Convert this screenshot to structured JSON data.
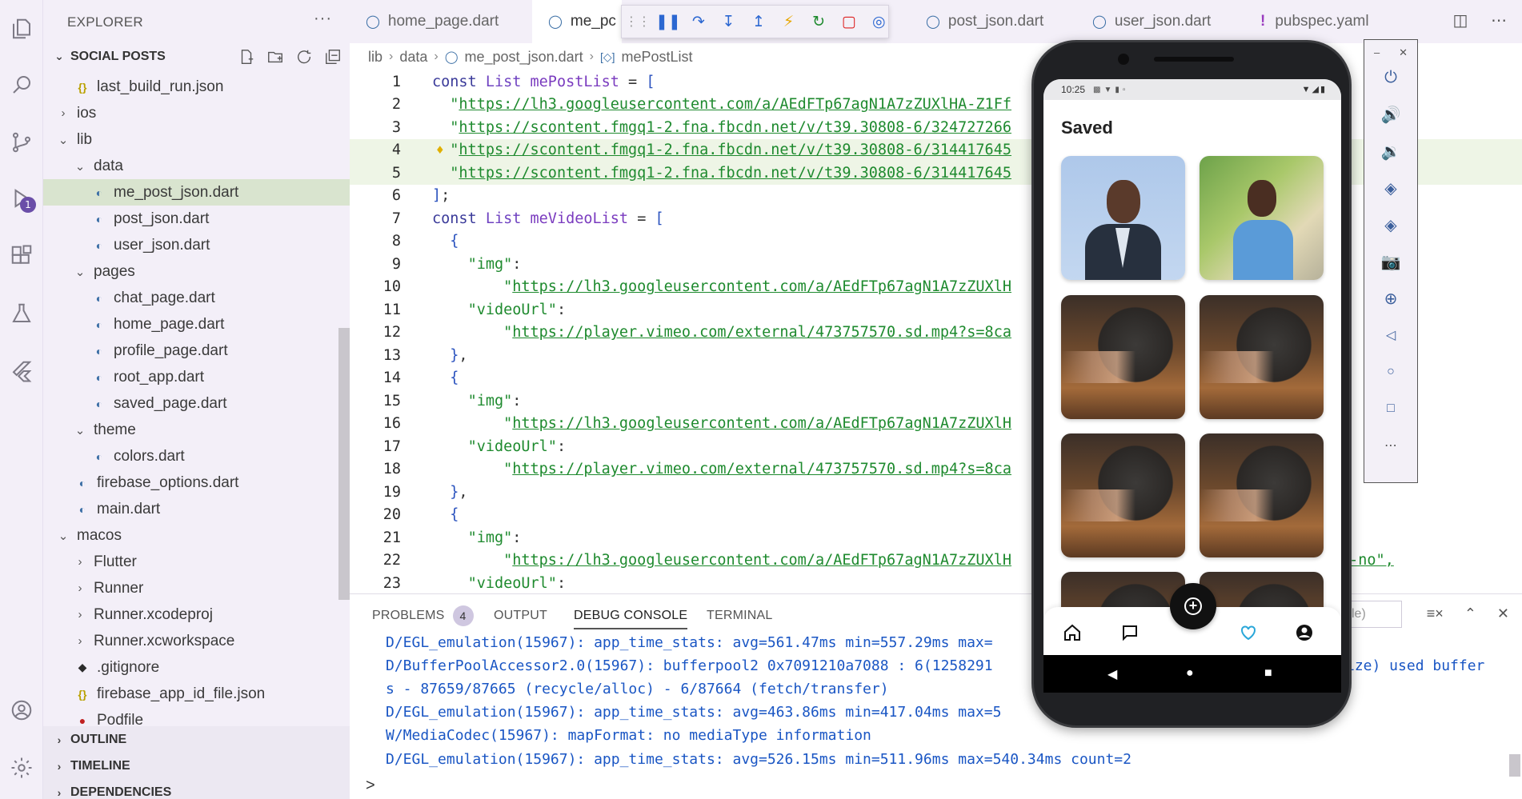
{
  "activity_bar": {
    "debug_badge": "1"
  },
  "sidebar": {
    "header": "EXPLORER",
    "more": "···",
    "project": "SOCIAL POSTS",
    "tree": [
      {
        "label": "last_build_run.json",
        "icon": "json-icon",
        "level": 2
      },
      {
        "label": "ios",
        "icon": "chevron-right-icon",
        "level": 1
      },
      {
        "label": "lib",
        "icon": "chevron-down-icon",
        "level": 1
      },
      {
        "label": "data",
        "icon": "chevron-down-icon",
        "level": 2
      },
      {
        "label": "me_post_json.dart",
        "icon": "dart-icon",
        "level": 3,
        "active": true
      },
      {
        "label": "post_json.dart",
        "icon": "dart-icon",
        "level": 3
      },
      {
        "label": "user_json.dart",
        "icon": "dart-icon",
        "level": 3
      },
      {
        "label": "pages",
        "icon": "chevron-down-icon",
        "level": 2
      },
      {
        "label": "chat_page.dart",
        "icon": "dart-icon",
        "level": 3
      },
      {
        "label": "home_page.dart",
        "icon": "dart-icon",
        "level": 3
      },
      {
        "label": "profile_page.dart",
        "icon": "dart-icon",
        "level": 3
      },
      {
        "label": "root_app.dart",
        "icon": "dart-icon",
        "level": 3
      },
      {
        "label": "saved_page.dart",
        "icon": "dart-icon",
        "level": 3
      },
      {
        "label": "theme",
        "icon": "chevron-down-icon",
        "level": 2
      },
      {
        "label": "colors.dart",
        "icon": "dart-icon",
        "level": 3
      },
      {
        "label": "firebase_options.dart",
        "icon": "dart-icon",
        "level": 2
      },
      {
        "label": "main.dart",
        "icon": "dart-icon",
        "level": 2
      },
      {
        "label": "macos",
        "icon": "chevron-down-icon",
        "level": 1
      },
      {
        "label": "Flutter",
        "icon": "chevron-right-icon",
        "level": 2
      },
      {
        "label": "Runner",
        "icon": "chevron-right-icon",
        "level": 2
      },
      {
        "label": "Runner.xcodeproj",
        "icon": "chevron-right-icon",
        "level": 2
      },
      {
        "label": "Runner.xcworkspace",
        "icon": "chevron-right-icon",
        "level": 2
      },
      {
        "label": ".gitignore",
        "icon": "git-icon",
        "level": 2
      },
      {
        "label": "firebase_app_id_file.json",
        "icon": "json-icon",
        "level": 2
      },
      {
        "label": "Podfile",
        "icon": "ruby-icon",
        "level": 2
      }
    ],
    "sections": [
      "OUTLINE",
      "TIMELINE",
      "DEPENDENCIES"
    ]
  },
  "tabs": [
    {
      "label": "home_page.dart",
      "icon": "dart-icon"
    },
    {
      "label": "me_pc",
      "icon": "dart-icon",
      "active": true
    },
    {
      "label": "post_json.dart",
      "icon": "dart-icon"
    },
    {
      "label": "user_json.dart",
      "icon": "dart-icon"
    },
    {
      "label": "pubspec.yaml",
      "icon": "yaml-icon"
    }
  ],
  "breadcrumb": {
    "parts": [
      "lib",
      "data",
      "me_post_json.dart",
      "mePostList"
    ]
  },
  "code": [
    {
      "n": "1",
      "segs": [
        [
          "kw",
          "const "
        ],
        [
          "kwb",
          "List "
        ],
        [
          "ident",
          "mePostList"
        ],
        [
          "punc",
          " = "
        ],
        [
          "brk",
          "["
        ]
      ]
    },
    {
      "n": "2",
      "segs": [
        [
          "punc",
          "  "
        ],
        [
          "str",
          "\""
        ],
        [
          "url",
          "https://lh3.googleusercontent.com/a/AEdFTp67agN1A7zZUXlHA-Z1Ff"
        ]
      ]
    },
    {
      "n": "3",
      "segs": [
        [
          "punc",
          "  "
        ],
        [
          "str",
          "\""
        ],
        [
          "url",
          "https://scontent.fmgq1-2.fna.fbcdn.net/v/t39.30808-6/324727266"
        ]
      ]
    },
    {
      "n": "4",
      "segs": [
        [
          "punc",
          "  "
        ],
        [
          "str",
          "\""
        ],
        [
          "url",
          "https://scontent.fmgq1-2.fna.fbcdn.net/v/t39.30808-6/314417645"
        ]
      ],
      "hl": true
    },
    {
      "n": "5",
      "segs": [
        [
          "punc",
          "  "
        ],
        [
          "str",
          "\""
        ],
        [
          "url",
          "https://scontent.fmgq1-2.fna.fbcdn.net/v/t39.30808-6/314417645"
        ]
      ],
      "hl": true
    },
    {
      "n": "6",
      "segs": [
        [
          "brk",
          "]"
        ],
        [
          "punc",
          ";"
        ]
      ]
    },
    {
      "n": "7",
      "segs": [
        [
          "kw",
          "const "
        ],
        [
          "kwb",
          "List "
        ],
        [
          "ident",
          "meVideoList"
        ],
        [
          "punc",
          " = "
        ],
        [
          "brk",
          "["
        ]
      ]
    },
    {
      "n": "8",
      "segs": [
        [
          "punc",
          "  "
        ],
        [
          "brk",
          "{"
        ]
      ]
    },
    {
      "n": "9",
      "segs": [
        [
          "punc",
          "    "
        ],
        [
          "str",
          "\"img\""
        ],
        [
          "punc",
          ":"
        ]
      ]
    },
    {
      "n": "10",
      "segs": [
        [
          "punc",
          "        "
        ],
        [
          "str",
          "\""
        ],
        [
          "url",
          "https://lh3.googleusercontent.com/a/AEdFTp67agN1A7zZUXlH"
        ]
      ]
    },
    {
      "n": "11",
      "segs": [
        [
          "punc",
          "    "
        ],
        [
          "str",
          "\"videoUrl\""
        ],
        [
          "punc",
          ":"
        ]
      ]
    },
    {
      "n": "12",
      "segs": [
        [
          "punc",
          "        "
        ],
        [
          "str",
          "\""
        ],
        [
          "url",
          "https://player.vimeo.com/external/473757570.sd.mp4?s=8ca"
        ]
      ]
    },
    {
      "n": "13",
      "segs": [
        [
          "punc",
          "  "
        ],
        [
          "brk",
          "}"
        ],
        [
          "punc",
          ","
        ]
      ]
    },
    {
      "n": "14",
      "segs": [
        [
          "punc",
          "  "
        ],
        [
          "brk",
          "{"
        ]
      ]
    },
    {
      "n": "15",
      "segs": [
        [
          "punc",
          "    "
        ],
        [
          "str",
          "\"img\""
        ],
        [
          "punc",
          ":"
        ]
      ]
    },
    {
      "n": "16",
      "segs": [
        [
          "punc",
          "        "
        ],
        [
          "str",
          "\""
        ],
        [
          "url",
          "https://lh3.googleusercontent.com/a/AEdFTp67agN1A7zZUXlH"
        ]
      ]
    },
    {
      "n": "17",
      "segs": [
        [
          "punc",
          "    "
        ],
        [
          "str",
          "\"videoUrl\""
        ],
        [
          "punc",
          ":"
        ]
      ]
    },
    {
      "n": "18",
      "segs": [
        [
          "punc",
          "        "
        ],
        [
          "str",
          "\""
        ],
        [
          "url",
          "https://player.vimeo.com/external/473757570.sd.mp4?s=8ca"
        ]
      ]
    },
    {
      "n": "19",
      "segs": [
        [
          "punc",
          "  "
        ],
        [
          "brk",
          "}"
        ],
        [
          "punc",
          ","
        ]
      ]
    },
    {
      "n": "20",
      "segs": [
        [
          "punc",
          "  "
        ],
        [
          "brk",
          "{"
        ]
      ]
    },
    {
      "n": "21",
      "segs": [
        [
          "punc",
          "    "
        ],
        [
          "str",
          "\"img\""
        ],
        [
          "punc",
          ":"
        ]
      ]
    },
    {
      "n": "22",
      "segs": [
        [
          "punc",
          "        "
        ],
        [
          "str",
          "\""
        ],
        [
          "url",
          "https://lh3.googleusercontent.com/a/AEdFTp67agN1A7zZUXlH"
        ]
      ]
    },
    {
      "n": "23",
      "segs": [
        [
          "punc",
          "    "
        ],
        [
          "str",
          "\"videoUrl\""
        ],
        [
          "punc",
          ":"
        ]
      ]
    }
  ],
  "code_tail_22": "w-no\",",
  "panel": {
    "tabs": [
      "PROBLEMS",
      "OUTPUT",
      "DEBUG CONSOLE",
      "TERMINAL"
    ],
    "problems_count": "4",
    "filter_placeholder": "le)",
    "console": [
      "D/EGL_emulation(15967): app_time_stats: avg=561.47ms min=557.29ms max=",
      "D/BufferPoolAccessor2.0(15967): bufferpool2 0x7091210a7088 : 6(1258291",
      "s - 87659/87665 (recycle/alloc) - 6/87664 (fetch/transfer)",
      "D/EGL_emulation(15967): app_time_stats: avg=463.86ms min=417.04ms max=5",
      "W/MediaCodec(15967): mapFormat: no mediaType information",
      "D/EGL_emulation(15967): app_time_stats: avg=526.15ms min=511.96ms max=540.34ms count=2"
    ],
    "console_tail_1": "ize) used buffer",
    "prompt": ">"
  },
  "phone": {
    "time": "10:25",
    "title": "Saved"
  }
}
